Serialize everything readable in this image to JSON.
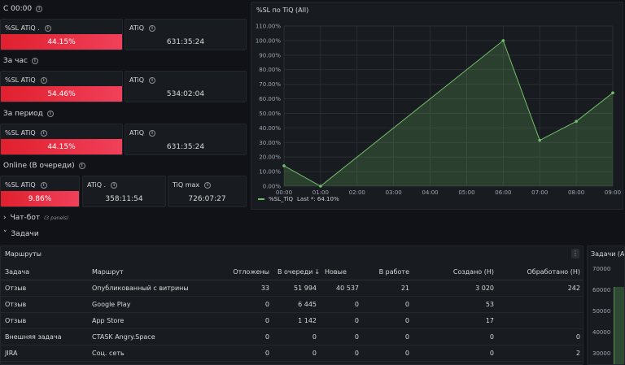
{
  "sections": {
    "s1": "С 00:00",
    "s2": "За час",
    "s3": "За период",
    "s4": "Online (В очереди)"
  },
  "stats": {
    "p1_sl_title": "%SL ATiQ .",
    "p1_sl_value": "44.15%",
    "p1_atiq_title": "ATiQ",
    "p1_atiq_value": "631:35:24",
    "p2_sl_title": "%SL ATiQ",
    "p2_sl_value": "54.46%",
    "p2_atiq_title": "ATiQ",
    "p2_atiq_value": "534:02:04",
    "p3_sl_title": "%SL ATiQ",
    "p3_sl_value": "44.15%",
    "p3_atiq_title": "ATiQ",
    "p3_atiq_value": "631:35:24",
    "p4_sl_title": "%SL ATiQ",
    "p4_sl_value": "9.86%",
    "p4_atiq_title": "ATiQ .",
    "p4_atiq_value": "358:11:54",
    "p4_tiq_title": "TiQ max",
    "p4_tiq_value": "726:07:27"
  },
  "chart_panel": {
    "title": "%SL по TiQ (All)",
    "legend_series": "%SL_TiQ",
    "legend_last": "Last *: 64.10%"
  },
  "chart_data": {
    "type": "area",
    "x": [
      "00:00",
      "01:00",
      "02:00",
      "03:00",
      "04:00",
      "05:00",
      "06:00",
      "07:00",
      "08:00",
      "09:00"
    ],
    "y_ticks": [
      "0.00%",
      "10.00%",
      "20.00%",
      "30.00%",
      "40.00%",
      "50.00%",
      "60.00%",
      "70.00%",
      "80.00%",
      "90.00%",
      "100.00%",
      "110.00%"
    ],
    "series": [
      {
        "name": "%SL_TiQ",
        "points": [
          [
            0,
            14
          ],
          [
            1,
            0
          ],
          [
            6,
            100
          ],
          [
            7,
            31.5
          ],
          [
            8,
            44.5
          ],
          [
            9,
            64.1
          ]
        ]
      }
    ],
    "ylim": [
      0,
      110
    ],
    "xlim": [
      0,
      9
    ],
    "grid": true,
    "legend": "bottom-left",
    "color": "#73bf69"
  },
  "rows": {
    "chatbot": "Чат-бот",
    "chatbot_sub": "(3 panels)",
    "tasks": "Задачи"
  },
  "table": {
    "title": "Маршруты",
    "menu": "⋮",
    "columns": [
      "Задача",
      "Маршрут",
      "Отложены",
      "В очереди",
      "Новые",
      "В работе",
      "Создано (Н)",
      "Обработано (Н)"
    ],
    "sort_arrow": "↓",
    "rows": [
      [
        "Отзыв",
        "Опубликованный с витрины",
        "33",
        "51 994",
        "40 537",
        "21",
        "3 020",
        "242"
      ],
      [
        "Отзыв",
        "Google Play",
        "0",
        "6 445",
        "0",
        "0",
        "53",
        ""
      ],
      [
        "Отзыв",
        "App Store",
        "0",
        "1 142",
        "0",
        "0",
        "17",
        ""
      ],
      [
        "Внешняя задача",
        "CTASK Angry.Space",
        "0",
        "0",
        "0",
        "0",
        "0",
        "0"
      ],
      [
        "JIRA",
        "Соц. сеть",
        "0",
        "0",
        "0",
        "0",
        "0",
        "2"
      ]
    ]
  },
  "mini_panel": {
    "title": "Задачи (All)",
    "ticks": [
      "70000",
      "60000",
      "50000",
      "40000",
      "30000"
    ]
  },
  "colors": {
    "accent_red": "#e0202e",
    "series_green": "#73bf69"
  }
}
